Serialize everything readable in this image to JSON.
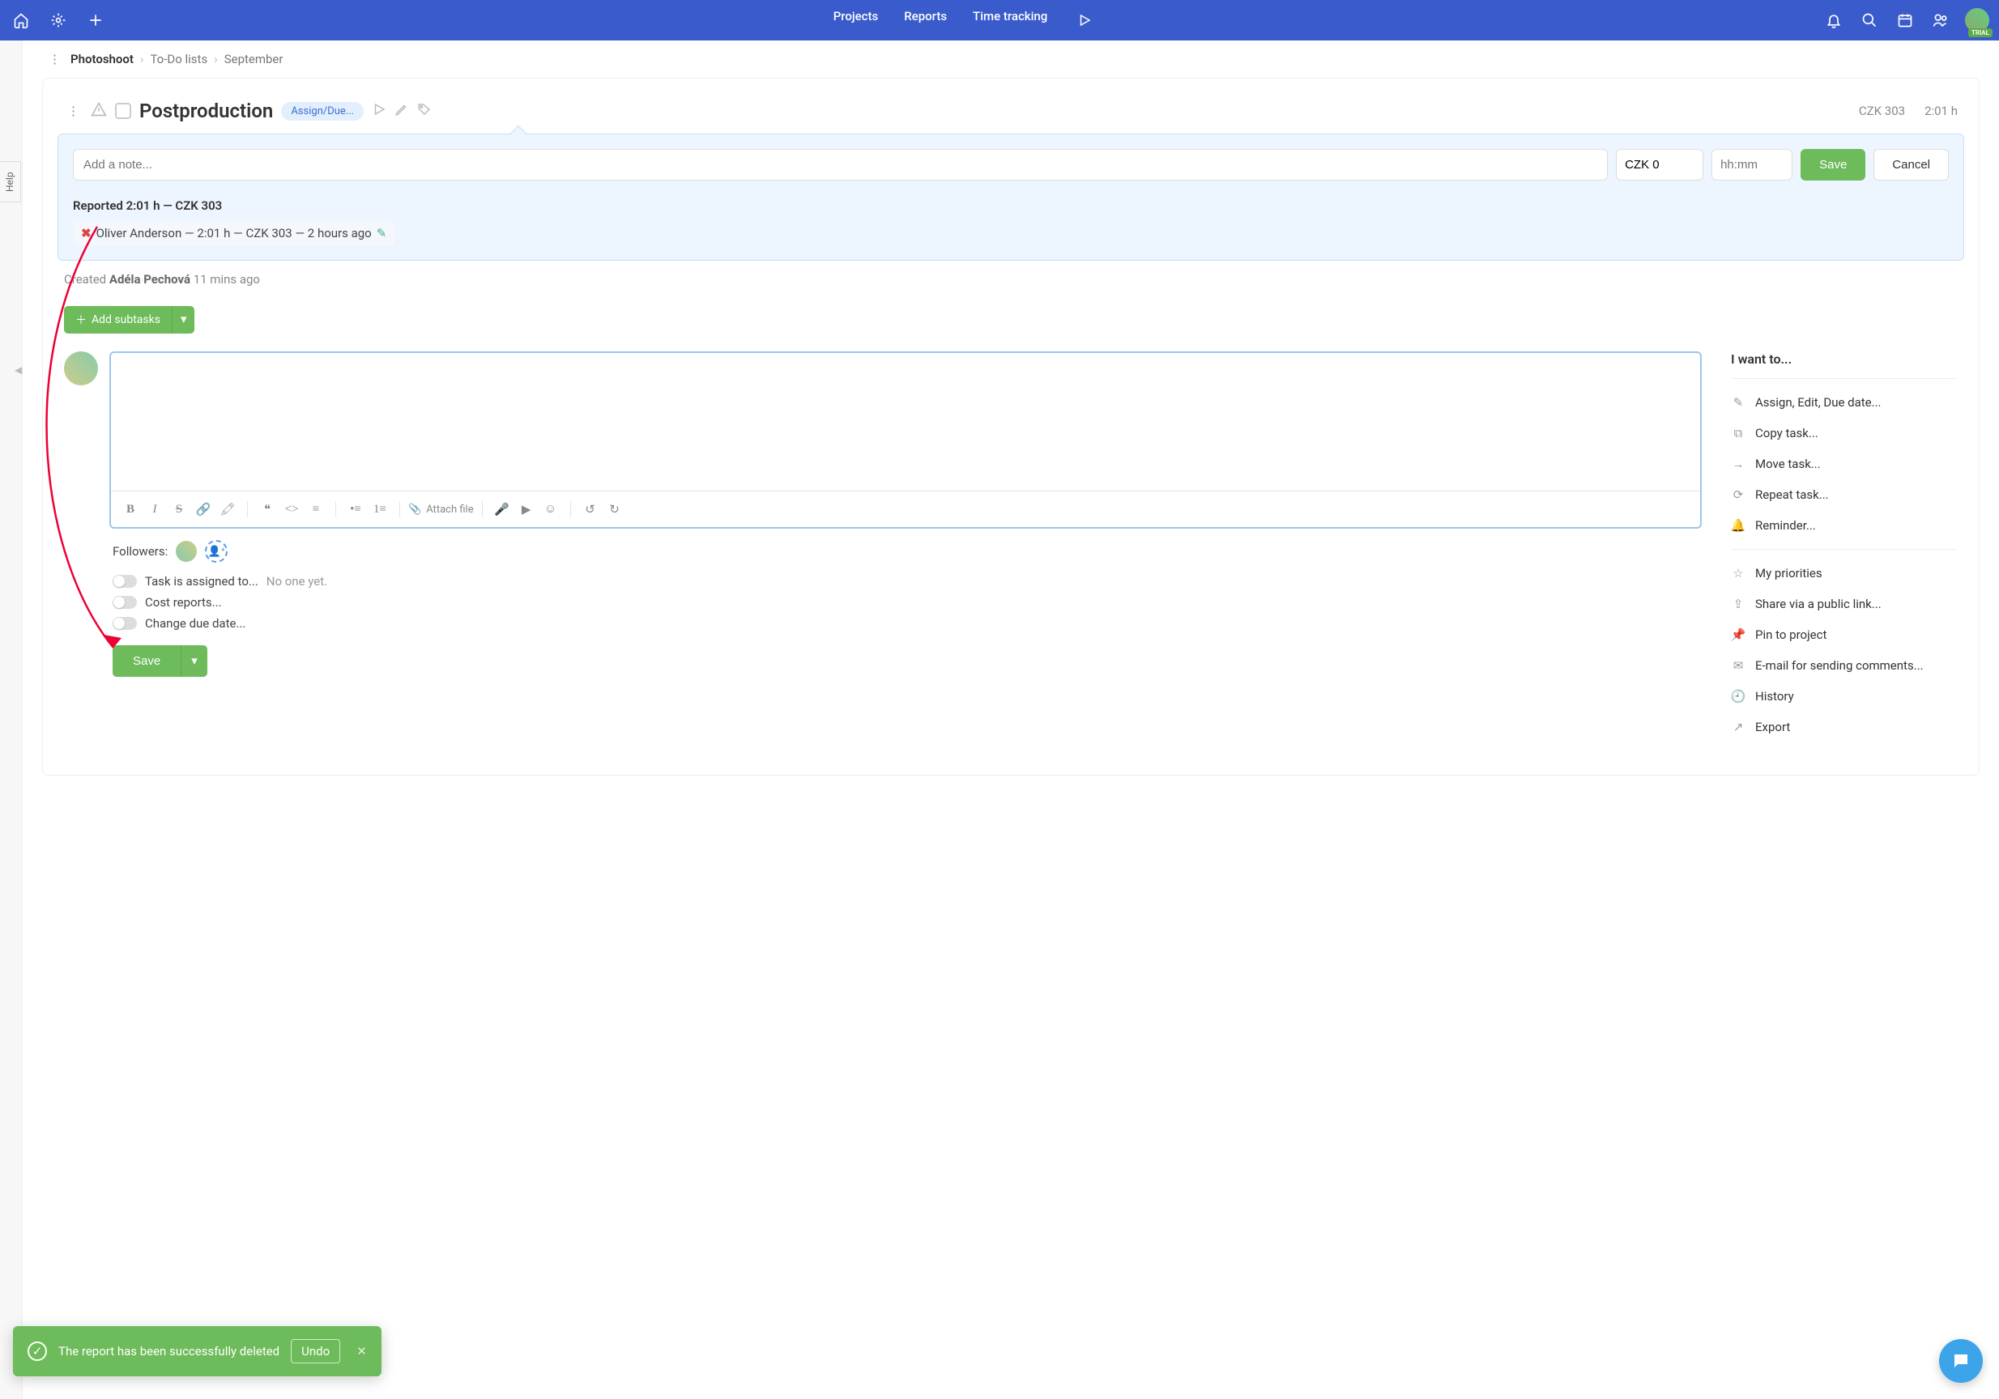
{
  "nav": {
    "projects": "Projects",
    "reports": "Reports",
    "time": "Time tracking"
  },
  "trial": "TRIAL",
  "breadcrumb": {
    "project": "Photoshoot",
    "list": "To-Do lists",
    "month": "September"
  },
  "task": {
    "title": "Postproduction",
    "assign_pill": "Assign/Due...",
    "money": "CZK 303",
    "hours": "2:01 h"
  },
  "note": {
    "placeholder": "Add a note...",
    "money_value": "CZK 0",
    "time_placeholder": "hh:mm",
    "save": "Save",
    "cancel": "Cancel"
  },
  "reported": {
    "header": "Reported 2:01 h — CZK 303",
    "line": "Oliver Anderson — 2:01 h — CZK 303 — 2 hours ago"
  },
  "created": {
    "label": "Created ",
    "by": "Adéla Pechová",
    "when": " 11 mins ago"
  },
  "add_sub": "Add subtasks",
  "followers_label": "Followers:",
  "toggles": {
    "assign": "Task is assigned to...",
    "assign_val": "No one yet.",
    "cost": "Cost reports...",
    "due": "Change due date..."
  },
  "save2": "Save",
  "attach": "Attach file",
  "sidebar": {
    "heading": "I want to...",
    "items": [
      "Assign, Edit, Due date...",
      "Copy task...",
      "Move task...",
      "Repeat task...",
      "Reminder...",
      "My priorities",
      "Share via a public link...",
      "Pin to project",
      "E-mail for sending comments...",
      "History",
      "Export"
    ]
  },
  "toast": {
    "msg": "The report has been successfully deleted",
    "undo": "Undo"
  },
  "help": "Help"
}
